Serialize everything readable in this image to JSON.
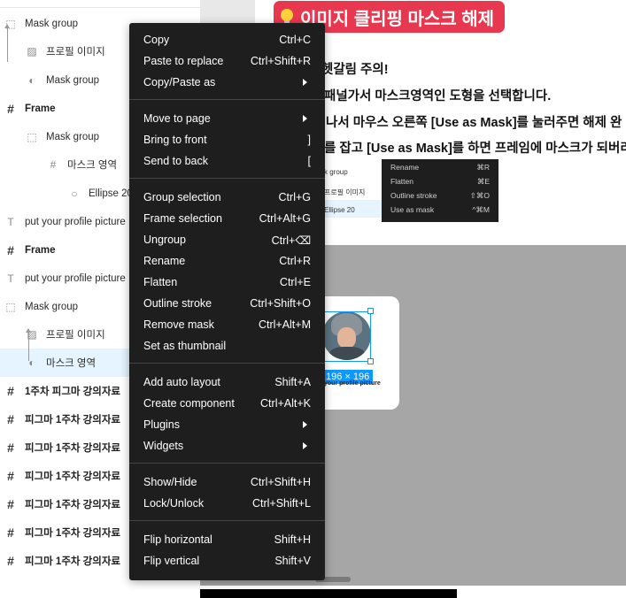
{
  "layers": [
    {
      "label": "Mask group",
      "icon": "dotted-square-icon"
    },
    {
      "label": "프로필 이미지",
      "icon": "image-icon"
    },
    {
      "label": "Mask group",
      "icon": "half-circle-icon"
    },
    {
      "label": "Frame",
      "icon": "hash-icon"
    },
    {
      "label": "Mask group",
      "icon": "dotted-square-icon"
    },
    {
      "label": "마스크 영역",
      "icon": "hash-icon"
    },
    {
      "label": "Ellipse 20",
      "icon": "circle-icon"
    },
    {
      "label": "put your profile picture",
      "icon": "text-icon"
    },
    {
      "label": "Frame",
      "icon": "hash-icon"
    },
    {
      "label": "put your profile picture",
      "icon": "text-icon"
    },
    {
      "label": "Mask group",
      "icon": "dotted-square-icon"
    },
    {
      "label": "프로필 이미지",
      "icon": "image-icon"
    },
    {
      "label": "마스크 영역",
      "icon": "half-circle-icon"
    },
    {
      "label": "1주차 피그마 강의자료",
      "icon": "hash-icon"
    },
    {
      "label": "피그마 1주차 강의자료",
      "icon": "hash-icon"
    },
    {
      "label": "피그마 1주차 강의자료",
      "icon": "hash-icon"
    },
    {
      "label": "피그마 1주차 강의자료",
      "icon": "hash-icon"
    },
    {
      "label": "피그마 1주차 강의자료",
      "icon": "hash-icon"
    },
    {
      "label": "피그마 1주차 강의자료",
      "icon": "hash-icon"
    },
    {
      "label": "피그마 1주차 강의자료",
      "icon": "hash-icon"
    }
  ],
  "doc": {
    "title": "이미지 클리핑 마스크 해제",
    "lines": [
      "헷갈림 주의!",
      "패널가서 마스크영역인 도형을 선택합니다.",
      "나서 마우스 오른쪽 [Use as Mask]를 눌러주면 해제 완",
      "를 잡고 [Use as Mask]를 하면 프레임에 마스크가 되버리"
    ],
    "mini_layers": [
      "k group",
      "프로필 이미지",
      "Ellipse 20"
    ],
    "mini_menu": [
      {
        "label": "Rename",
        "shortcut": "⌘R"
      },
      {
        "label": "Flatten",
        "shortcut": "⌘E"
      },
      {
        "label": "Outline stroke",
        "shortcut": "⇧⌘O"
      },
      {
        "label": "Use as mask",
        "shortcut": "^⌘M"
      }
    ],
    "size_label": "196 × 196",
    "card_caption": "your profile picture"
  },
  "context_menu": {
    "groups": [
      [
        {
          "label": "Copy",
          "shortcut": "Ctrl+C"
        },
        {
          "label": "Paste to replace",
          "shortcut": "Ctrl+Shift+R"
        },
        {
          "label": "Copy/Paste as",
          "shortcut": "",
          "submenu": true
        }
      ],
      [
        {
          "label": "Move to page",
          "shortcut": "",
          "submenu": true
        },
        {
          "label": "Bring to front",
          "shortcut": "]"
        },
        {
          "label": "Send to back",
          "shortcut": "["
        }
      ],
      [
        {
          "label": "Group selection",
          "shortcut": "Ctrl+G"
        },
        {
          "label": "Frame selection",
          "shortcut": "Ctrl+Alt+G"
        },
        {
          "label": "Ungroup",
          "shortcut": "Ctrl+⌫"
        },
        {
          "label": "Rename",
          "shortcut": "Ctrl+R"
        },
        {
          "label": "Flatten",
          "shortcut": "Ctrl+E"
        },
        {
          "label": "Outline stroke",
          "shortcut": "Ctrl+Shift+O"
        },
        {
          "label": "Remove mask",
          "shortcut": "Ctrl+Alt+M"
        },
        {
          "label": "Set as thumbnail",
          "shortcut": ""
        }
      ],
      [
        {
          "label": "Add auto layout",
          "shortcut": "Shift+A"
        },
        {
          "label": "Create component",
          "shortcut": "Ctrl+Alt+K"
        },
        {
          "label": "Plugins",
          "shortcut": "",
          "submenu": true
        },
        {
          "label": "Widgets",
          "shortcut": "",
          "submenu": true
        }
      ],
      [
        {
          "label": "Show/Hide",
          "shortcut": "Ctrl+Shift+H"
        },
        {
          "label": "Lock/Unlock",
          "shortcut": "Ctrl+Shift+L"
        }
      ],
      [
        {
          "label": "Flip horizontal",
          "shortcut": "Shift+H"
        },
        {
          "label": "Flip vertical",
          "shortcut": "Shift+V"
        }
      ]
    ]
  }
}
